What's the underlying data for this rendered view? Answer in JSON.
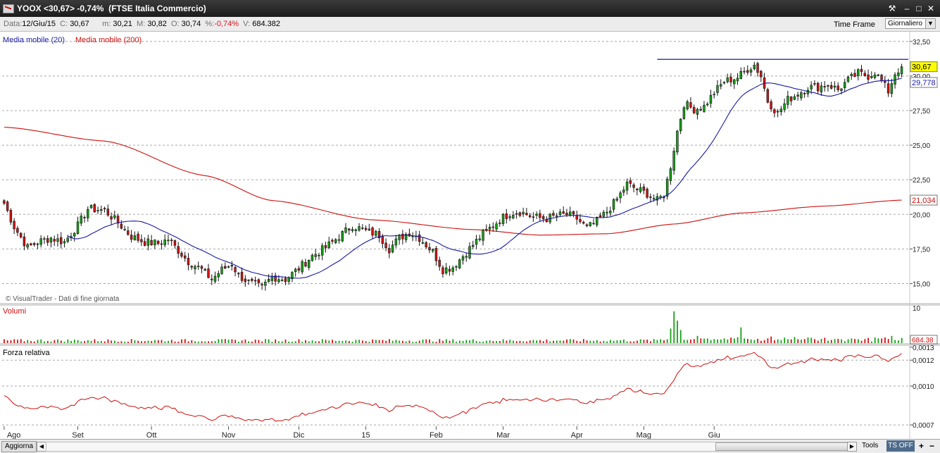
{
  "window": {
    "title": "YOOX <30,67> -0,74%  (FTSE Italia Commercio)",
    "controls": {
      "tool": "⚒",
      "minimize": "–",
      "maximize": "□",
      "close": "✕"
    }
  },
  "info_bar": {
    "date_label": "Data:",
    "date_value": "12/Giu/15",
    "close_label": "C:",
    "close_value": "30,67",
    "min_label": "m:",
    "min_value": "30,21",
    "max_label": "M:",
    "max_value": "30,82",
    "open_label": "O:",
    "open_value": "30,74",
    "pct_label": "%:",
    "pct_value": "-0,74%",
    "vol_label": "V:",
    "vol_value": "684.382",
    "time_frame_label": "Time Frame",
    "period_value": "Giornaliero"
  },
  "bottom_bar": {
    "update_label": "Aggiorna",
    "tools_label": "Tools",
    "ts_label": "TS OFF",
    "plus": "+",
    "minus": "−"
  },
  "chart_data": [
    {
      "type": "candlestick",
      "panel": "price",
      "overlay_legend": [
        {
          "name": "Media mobile (20)",
          "color": "#1a1aa0"
        },
        {
          "name": "Media mobile (200)",
          "color": "#cc1010"
        }
      ],
      "watermark": "© VisualTrader - Dati di fine giornata",
      "ylim": [
        13.6,
        33.2
      ],
      "y_ticks": [
        15.0,
        17.5,
        20.0,
        22.5,
        25.0,
        27.5,
        30.0,
        32.5
      ],
      "y_tick_labels": [
        "15,00",
        "17,50",
        "20,00",
        "22,50",
        "25,00",
        "27,50",
        "30,00",
        "32,50"
      ],
      "last_price_label": "30,67",
      "ma20_label": "29,778",
      "ma200_label": "21,034",
      "resistance_line": {
        "value": 31.2,
        "from_index": 195,
        "to_index": 270
      },
      "anchors": {
        "close": [
          [
            0,
            20.8
          ],
          [
            3,
            19.1
          ],
          [
            7,
            17.6
          ],
          [
            10,
            18.0
          ],
          [
            14,
            18.3
          ],
          [
            18,
            18.0
          ],
          [
            22,
            19.2
          ],
          [
            25,
            20.4
          ],
          [
            30,
            20.3
          ],
          [
            34,
            19.4
          ],
          [
            38,
            18.4
          ],
          [
            42,
            18.0
          ],
          [
            46,
            17.9
          ],
          [
            49,
            18.2
          ],
          [
            52,
            17.4
          ],
          [
            55,
            16.6
          ],
          [
            59,
            16.0
          ],
          [
            62,
            15.3
          ],
          [
            65,
            16.0
          ],
          [
            68,
            16.4
          ],
          [
            70,
            15.6
          ],
          [
            73,
            15.1
          ],
          [
            77,
            14.7
          ],
          [
            80,
            15.5
          ],
          [
            84,
            15.3
          ],
          [
            88,
            16.1
          ],
          [
            92,
            17.0
          ],
          [
            96,
            17.6
          ],
          [
            100,
            18.4
          ],
          [
            104,
            19.2
          ],
          [
            108,
            18.8
          ],
          [
            112,
            18.5
          ],
          [
            115,
            17.5
          ],
          [
            118,
            18.3
          ],
          [
            121,
            18.7
          ],
          [
            124,
            18.3
          ],
          [
            128,
            17.3
          ],
          [
            131,
            16.0
          ],
          [
            134,
            16.2
          ],
          [
            137,
            17.0
          ],
          [
            140,
            17.8
          ],
          [
            143,
            18.6
          ],
          [
            146,
            19.2
          ],
          [
            148,
            19.6
          ],
          [
            151,
            20.1
          ],
          [
            154,
            20.2
          ],
          [
            158,
            19.8
          ],
          [
            162,
            19.7
          ],
          [
            165,
            19.9
          ],
          [
            168,
            20.0
          ],
          [
            171,
            19.7
          ],
          [
            174,
            19.0
          ],
          [
            177,
            19.5
          ],
          [
            180,
            20.2
          ],
          [
            183,
            21.1
          ],
          [
            186,
            22.2
          ],
          [
            189,
            21.8
          ],
          [
            192,
            21.5
          ],
          [
            195,
            21.0
          ],
          [
            197,
            21.4
          ],
          [
            199,
            23.5
          ],
          [
            201,
            26.0
          ],
          [
            203,
            28.0
          ],
          [
            206,
            27.6
          ],
          [
            209,
            27.8
          ],
          [
            212,
            28.8
          ],
          [
            215,
            29.6
          ],
          [
            219,
            29.9
          ],
          [
            222,
            30.5
          ],
          [
            224,
            30.8
          ],
          [
            226,
            30.0
          ],
          [
            228,
            28.2
          ],
          [
            231,
            27.3
          ],
          [
            234,
            28.3
          ],
          [
            237,
            28.7
          ],
          [
            240,
            29.2
          ],
          [
            243,
            29.2
          ],
          [
            246,
            29.4
          ],
          [
            249,
            29.0
          ],
          [
            252,
            29.7
          ],
          [
            255,
            30.2
          ],
          [
            258,
            30.0
          ],
          [
            260,
            30.3
          ],
          [
            262,
            29.6
          ],
          [
            264,
            28.9
          ],
          [
            266,
            30.2
          ],
          [
            268,
            30.67
          ]
        ],
        "volume_unit": "10 = axis top",
        "volume_last_label": "684.38",
        "volume_spikes": [
          [
            199,
            3.9
          ],
          [
            200,
            8.5
          ],
          [
            201,
            6.0
          ],
          [
            202,
            3.5
          ],
          [
            220,
            4.2
          ]
        ],
        "relative_strength_labels": [
          "0,0013",
          "0,0012",
          "0,0010",
          "0,0007"
        ],
        "relative_strength_ylim": [
          0.00069,
          0.00131
        ]
      }
    }
  ],
  "panels": {
    "volume_title": "Volumi",
    "volume_axis_label": "10",
    "rs_title": "Forza relativa"
  },
  "x_axis": {
    "labels": [
      {
        "label": "Ago",
        "index": 0
      },
      {
        "label": "Set",
        "index": 22
      },
      {
        "label": "Ott",
        "index": 44
      },
      {
        "label": "Nov",
        "index": 67
      },
      {
        "label": "Dic",
        "index": 88
      },
      {
        "label": "15",
        "index": 108
      },
      {
        "label": "Feb",
        "index": 129
      },
      {
        "label": "Mar",
        "index": 149
      },
      {
        "label": "Apr",
        "index": 171
      },
      {
        "label": "Mag",
        "index": 191
      },
      {
        "label": "Giu",
        "index": 212
      }
    ]
  },
  "colors": {
    "up": "#18a018",
    "down": "#d21414",
    "ma20": "#1a1aa0",
    "ma200": "#cc1010",
    "rs": "#cc1010",
    "grid": "#a8a8a8",
    "last_price_bg": "#ffff00"
  }
}
